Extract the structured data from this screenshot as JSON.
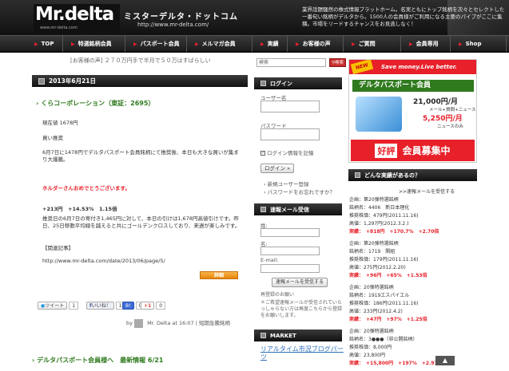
{
  "header": {
    "logo_main": "Mr.delta",
    "logo_sub": "www.mr-delta.com",
    "site_name_jp": "ミスターデルタ・ドットコム",
    "site_url": "http://www.mr-delta.com/",
    "description": "業界話題騒然の株式情報プラットホーム。名実ともにトップ銘柄を次々とセレクトした一番旬い銘柄がデルタから。1500人の会員様がご利用になる主要のパイプがここに集積。市場をリードするチャンスをお見逃しなく！"
  },
  "nav": {
    "items": [
      {
        "label": "TOP"
      },
      {
        "label": "特選銘柄会員"
      },
      {
        "label": "パスポート会員"
      },
      {
        "label": "メルマガ会員"
      },
      {
        "label": "実績"
      },
      {
        "label": "お客様の声"
      },
      {
        "label": "ご質問"
      },
      {
        "label": "会員専用"
      },
      {
        "label": "Shop"
      }
    ]
  },
  "notice": "[お客様の声] ２７０万円手で半月で５０万はすばらしい",
  "post": {
    "date": "2013年6月21日",
    "title": "くらコーポレーション（東証：2695）",
    "price": "現在値 1678円",
    "action": "買い推奨",
    "body1": "6月7日に1478円でデルタパスポート会員銘柄にて推奨後、本日も大きな買いが集まり大爆騰。",
    "congrats": "ホルダーさんおめでとうございます。",
    "gain": "+213円　+14.53%　1.15倍",
    "body2a": "推奨日の6月7日の寄付き1,465円に対して、本日の引けは1,678円高値引けです。昨日、25日移動平均線を越えると共にゴールデンクロスしており、来週が楽しみです。",
    "related_label": "【関連記事】",
    "related_url": "http://www.mr-delta.com/date/2013/06/page/5/",
    "detail_label": "詳細",
    "tweet_label": "ツイート",
    "tweet_count": "1",
    "like_label": "いいね！",
    "like_count": "1",
    "bookmark_count": "0",
    "gplus_label": "+1",
    "gplus_count": "0",
    "byline_by": "by",
    "byline_text": "Mr. Delta at 16:07 | 短期急騰銘柄",
    "next_title": "デルタパスポート会員様へ　最新情報 6/21"
  },
  "search": {
    "placeholder": "検索",
    "button": "検索"
  },
  "login": {
    "title": "ログイン",
    "user_label": "ユーザー名",
    "pass_label": "パスワード",
    "remember_label": "ログイン情報を記憶",
    "button": "ログイン »",
    "register": "新規ユーザー登録",
    "forgot": "パスワードをお忘れですか？"
  },
  "mail": {
    "title": "速報メール受信",
    "last_label": "姓:",
    "first_label": "名:",
    "email_label": "E-mail:",
    "button": "速報メールを受信する",
    "note_title": "再登録のお願い",
    "note": "＊ご希望速報メールが受信されていらっしゃらない方は再度こちらから登録をお願いします。"
  },
  "market": {
    "title": "MARKET",
    "link": "リアルタイム市況ブログパーツ"
  },
  "banner": {
    "new": "NEW",
    "tagline": "Save money.Live better.",
    "title": "デルタパスポート会員",
    "price1": "21,000円/月",
    "sub1": "メール+質問+ニュース",
    "price2": "5,250円/月",
    "sub2": "ニュースのみ",
    "badge": "好評",
    "recruit": "会員募集中"
  },
  "results": {
    "title": "どんな実績があるの？",
    "link": ">>速報メールを受信する",
    "entries": [
      {
        "line1": "企画：第20弾特選銘柄",
        "line2": "銘柄名：4406　新日本理化",
        "line3": "推奨株価：479円(2011.11.16)",
        "line4": "高値：1,297円(2012.3.2.)",
        "gain": "実績：　+818円　+170.7%　+2.70倍"
      },
      {
        "line1": "企画：第20弾特選銘柄",
        "line2": "銘柄名：1719　関組",
        "line3": "推奨株価：179円(2011.11.16)",
        "line4": "高値：275円(2012.2.20)",
        "gain": "実績：　+96円　+65%　+1.53倍"
      },
      {
        "line1": "企画：20弾特選銘柄",
        "line2": "銘柄名：1919エスパイエル",
        "line3": "推奨株価：186円(2011.11.16)",
        "line4": "高値：233円(2012.4.2)",
        "gain": "実績：　+47円　+97%　+1.25倍"
      },
      {
        "line1": "企画：20弾特選銘柄",
        "line2": "銘柄名：3●●●（非公開銘柄）",
        "line3": "推奨株価：8,000円",
        "line4": "高値：23,800円",
        "gain": "実績：　+15,800円　+197%　+2.97倍"
      }
    ]
  },
  "colors": {
    "accent": "#e8202a",
    "title_green": "#2f7a1e",
    "bar_dark": "#1c1c1c",
    "detail_orange": "#e8860c"
  }
}
